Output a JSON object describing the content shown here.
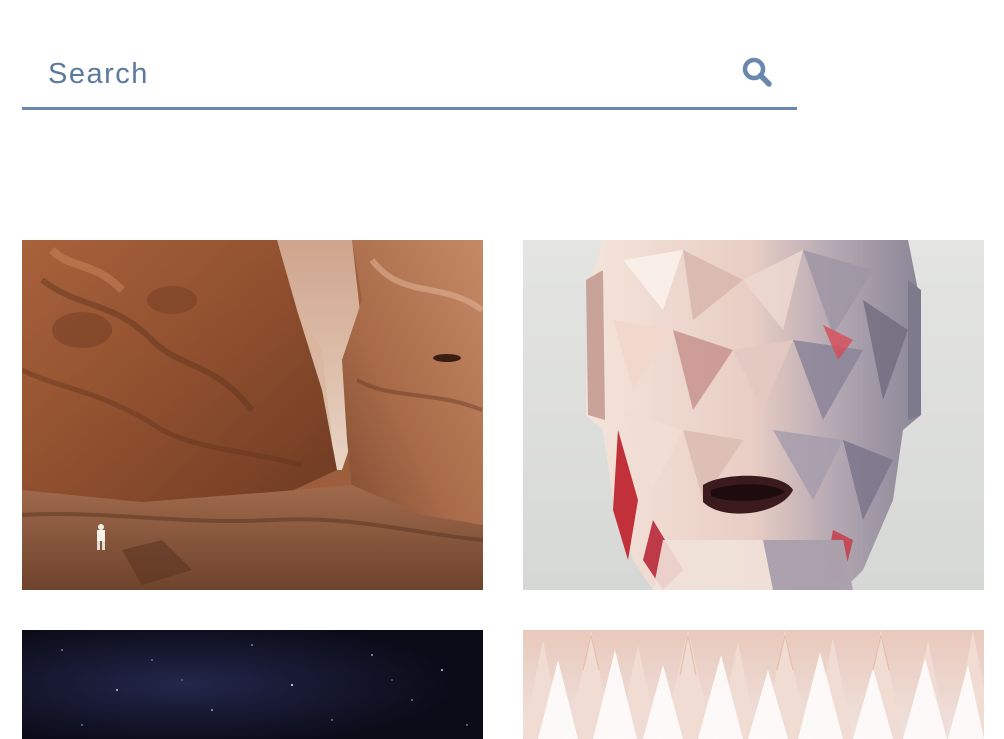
{
  "search": {
    "placeholder": "Search",
    "icon": "search-icon",
    "accent_color": "#6a88ad",
    "text_color": "#5c7a9b"
  },
  "gallery": {
    "tiles": [
      {
        "name": "canyon-photo"
      },
      {
        "name": "low-poly-face-render"
      },
      {
        "name": "starry-night-sky"
      },
      {
        "name": "snowy-pine-forest"
      }
    ]
  }
}
